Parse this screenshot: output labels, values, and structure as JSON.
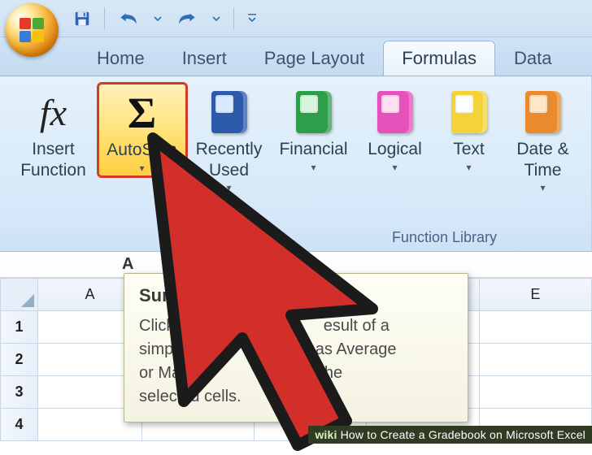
{
  "qat": {
    "save": "save",
    "undo": "undo",
    "redo": "redo"
  },
  "tabs": {
    "home": "Home",
    "insert": "Insert",
    "page_layout": "Page Layout",
    "formulas": "Formulas",
    "data": "Data"
  },
  "ribbon": {
    "insert_function": "Insert\nFunction",
    "autosum": "AutoSum",
    "recently_used": "Recently\nUsed",
    "financial": "Financial",
    "logical": "Logical",
    "text": "Text",
    "date_time": "Date &\nTime",
    "group_title": "Function Library"
  },
  "name_box": "A",
  "columns": {
    "A": "A",
    "E": "E"
  },
  "rows": {
    "1": "1",
    "2": "2",
    "3": "3",
    "4": "4"
  },
  "tooltip": {
    "title": "Sum (Al",
    "line1": "Click he",
    "line2": "esult of a",
    "line3": "simple",
    "line4": "such as Average",
    "line5": "or Maxi",
    "line6": "after the",
    "line7": "selected cells."
  },
  "caption": {
    "brand": "wiki",
    "text": "How to Create a Gradebook on Microsoft Excel"
  }
}
